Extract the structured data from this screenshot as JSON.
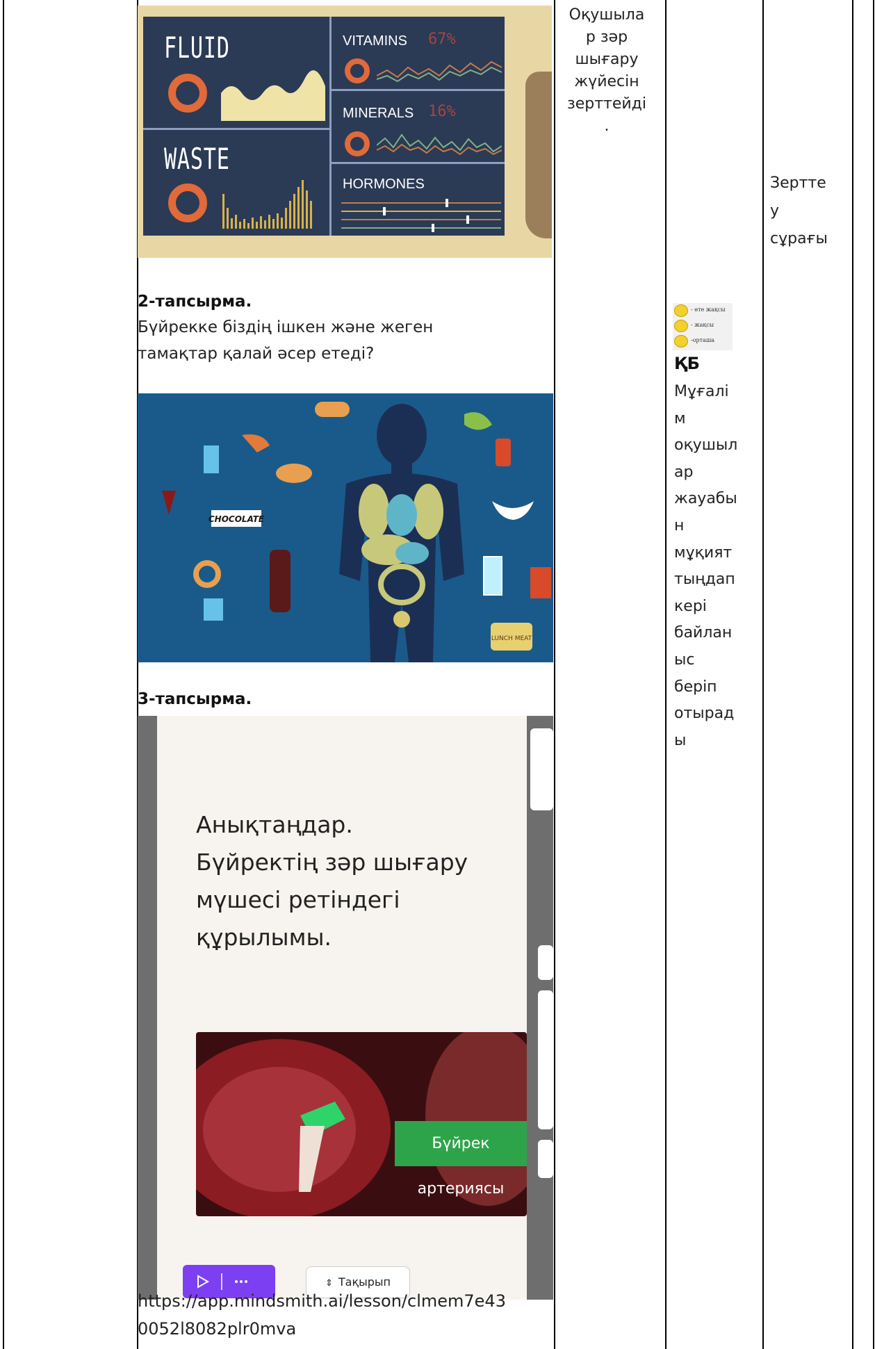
{
  "column3": {
    "lines": [
      "Оқушыла",
      "р зәр",
      "шығару",
      "жүйесін",
      "зерттейді",
      "."
    ]
  },
  "column4": {
    "legend": [
      "- өте жақсы",
      "- жақсы",
      "-орташа"
    ],
    "heading": "ҚБ",
    "lines": [
      "Мұғалі",
      "м",
      "оқушыл",
      "ар",
      "жауабы",
      "н",
      "мұқият",
      "тыңдап",
      "кері",
      "байлан",
      "ыс",
      "беріп",
      "отырад",
      "ы"
    ]
  },
  "column5": {
    "lines": [
      "Зертте",
      "у",
      "сұрағы"
    ]
  },
  "infographic": {
    "fluid": "FLUID",
    "waste": "WASTE",
    "vitamins": "VITAMINS",
    "vitamins_pct": "67%",
    "minerals": "MINERALS",
    "minerals_pct": "16%",
    "hormones": "HORMONES"
  },
  "food_image": {
    "chocolate": "CHOCOLATE",
    "lunch_meat": "LUNCH MEAT"
  },
  "task2": {
    "title": "2-тапсырма.",
    "text_line1": "Бүйрекке біздің ішкен және жеген",
    "text_line2": "тамақтар қалай әсер етеді?"
  },
  "task3": {
    "title": "3-тапсырма."
  },
  "slide": {
    "heading": [
      "Анықтаңдар.",
      "Бүйректің зәр шығару",
      "мүшесі ретіндегі",
      "құрылымы."
    ],
    "video_label": "Бүйрек артериясы",
    "topic_button": "Тақырып"
  },
  "link": {
    "line1": "https://app.mindsmith.ai/lesson/clmem7e43",
    "line2": "0052l8082plr0mva"
  },
  "colors": {
    "accent_purple": "#7d3ff2",
    "video_label_green": "#2ea44a",
    "dashboard_bg": "#2b3a55",
    "food_bg": "#1a5a8a"
  }
}
